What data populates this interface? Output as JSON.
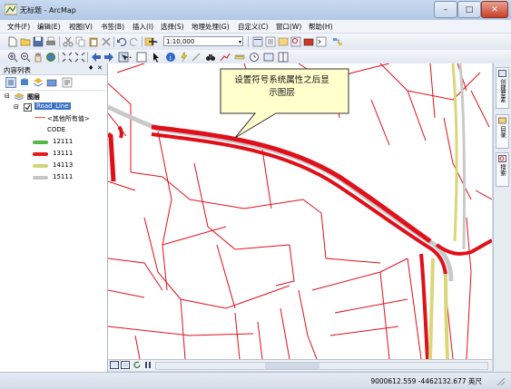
{
  "window": {
    "title": "无标题 - ArcMap",
    "buttons": {
      "minimize": "–",
      "maximize": "□",
      "close": "✕"
    }
  },
  "menu": [
    "文件(F)",
    "编辑(E)",
    "视图(V)",
    "书签(B)",
    "插入(I)",
    "选择(S)",
    "地理处理(G)",
    "自定义(C)",
    "窗口(W)",
    "帮助(H)"
  ],
  "toolbar": {
    "scale": "1:10,000",
    "scale_dropdown": "▾"
  },
  "toc": {
    "title": "内容列表",
    "pin": "♦",
    "close": "✕",
    "root_layer": "图层",
    "layer_name": "Road_Line",
    "other_values": "<其他所有值>",
    "field": "CODE",
    "legend": [
      {
        "label": "12111",
        "color": "#52b848"
      },
      {
        "label": "13111",
        "color": "#e31c1c"
      },
      {
        "label": "14113",
        "color": "#cfd67a"
      },
      {
        "label": "15111",
        "color": "#c6c6c6"
      }
    ],
    "other_values_color": "#e36a4a"
  },
  "callout": {
    "text_line1": "设置符号系统属性之后显",
    "text_line2": "示图层",
    "fill": "#ffffcc"
  },
  "dock": {
    "tabs": [
      "创建要素",
      "目录",
      "搜索"
    ]
  },
  "status": {
    "coordinates": "9000612.559  -4462132.677 英尺"
  },
  "colors": {
    "road_red": "#e0101a",
    "road_gray": "#c9c9c9",
    "road_yellow": "#d8d87a",
    "road_green": "#52b848"
  }
}
